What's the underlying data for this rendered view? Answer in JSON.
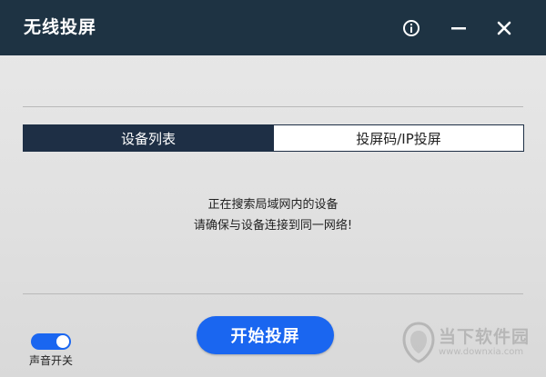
{
  "window": {
    "title": "无线投屏",
    "titlebar_color": "#1e3343",
    "accent_color": "#1a66f0"
  },
  "titlebar_buttons": {
    "info_icon": "info-icon",
    "minimize_icon": "minimize-icon",
    "close_icon": "close-icon"
  },
  "tabs": [
    {
      "label": "设备列表",
      "active": true
    },
    {
      "label": "投屏码/IP投屏",
      "active": false
    }
  ],
  "status": {
    "line1": "正在搜索局域网内的设备",
    "line2": "请确保与设备连接到同一网络!"
  },
  "start_button": {
    "label": "开始投屏"
  },
  "sound_toggle": {
    "label": "声音开关",
    "on": true
  },
  "watermark": {
    "name": "当下软件园",
    "url": "www.downxia.com"
  }
}
